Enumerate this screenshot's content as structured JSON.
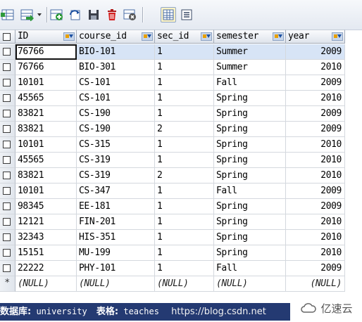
{
  "toolbar": {
    "buttons": [
      {
        "name": "grid-icon"
      },
      {
        "name": "export-dropdown-icon"
      },
      {
        "name": "add-row-icon"
      },
      {
        "name": "refresh-icon"
      },
      {
        "name": "save-icon"
      },
      {
        "name": "delete-icon"
      },
      {
        "name": "cancel-icon"
      },
      {
        "name": "grid-view-icon"
      },
      {
        "name": "form-view-icon"
      }
    ]
  },
  "table": {
    "columns": [
      "ID",
      "course_id",
      "sec_id",
      "semester",
      "year"
    ],
    "rows": [
      [
        "76766",
        "BIO-101",
        "1",
        "Summer",
        "2009"
      ],
      [
        "76766",
        "BIO-301",
        "1",
        "Summer",
        "2010"
      ],
      [
        "10101",
        "CS-101",
        "1",
        "Fall",
        "2009"
      ],
      [
        "45565",
        "CS-101",
        "1",
        "Spring",
        "2010"
      ],
      [
        "83821",
        "CS-190",
        "1",
        "Spring",
        "2009"
      ],
      [
        "83821",
        "CS-190",
        "2",
        "Spring",
        "2009"
      ],
      [
        "10101",
        "CS-315",
        "1",
        "Spring",
        "2010"
      ],
      [
        "45565",
        "CS-319",
        "1",
        "Spring",
        "2010"
      ],
      [
        "83821",
        "CS-319",
        "2",
        "Spring",
        "2010"
      ],
      [
        "10101",
        "CS-347",
        "1",
        "Fall",
        "2009"
      ],
      [
        "98345",
        "EE-181",
        "1",
        "Spring",
        "2009"
      ],
      [
        "12121",
        "FIN-201",
        "1",
        "Spring",
        "2010"
      ],
      [
        "32343",
        "HIS-351",
        "1",
        "Spring",
        "2010"
      ],
      [
        "15151",
        "MU-199",
        "1",
        "Spring",
        "2010"
      ],
      [
        "22222",
        "PHY-101",
        "1",
        "Fall",
        "2009"
      ]
    ],
    "new_row": [
      "(NULL)",
      "(NULL)",
      "(NULL)",
      "(NULL)",
      "(NULL)"
    ],
    "new_row_marker": "*"
  },
  "status": {
    "db_label": "数据库:",
    "db_value": "university",
    "table_label": "表格:",
    "table_value": "teaches",
    "url": "https://blog.csdn.net"
  },
  "watermark": {
    "text": "亿速云"
  },
  "colors": {
    "status_bg": "#243a72",
    "selected_row": "#d7e4f6",
    "header_bg": "#e6eaf1"
  }
}
